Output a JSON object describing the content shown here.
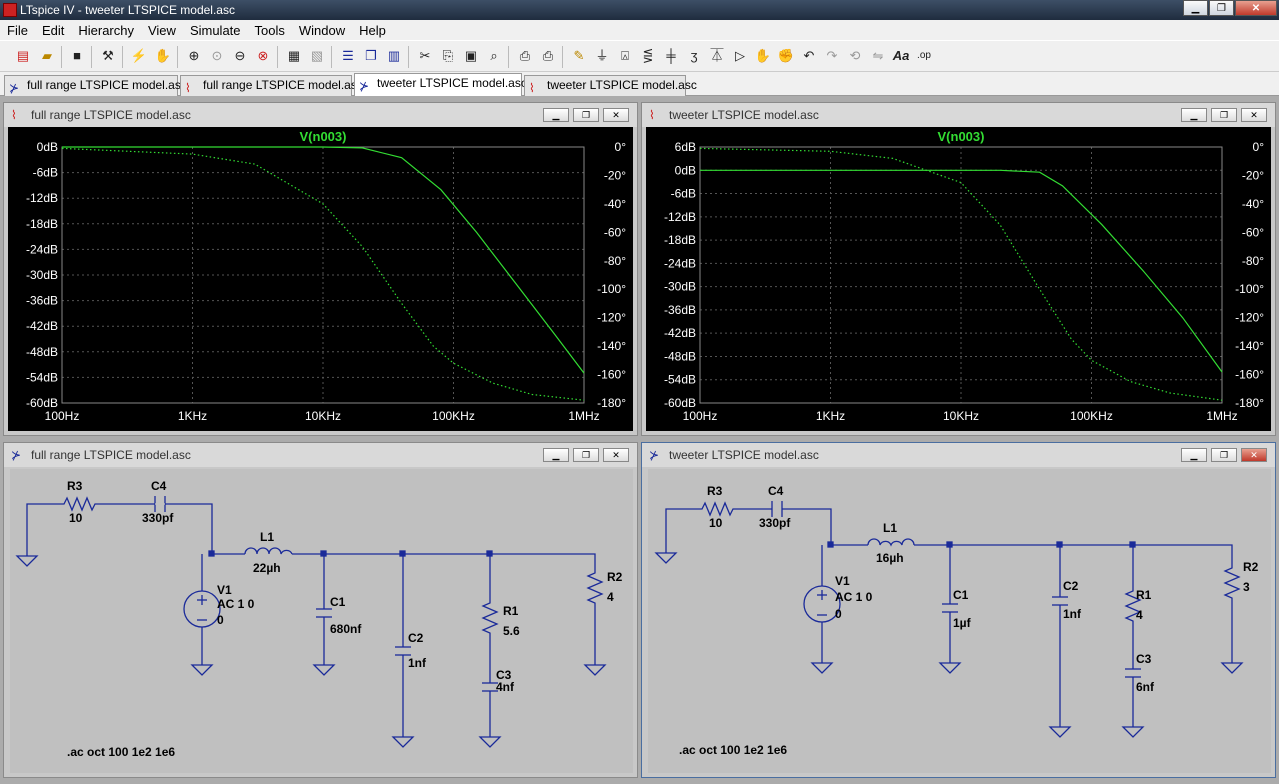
{
  "app": {
    "title": "LTspice IV - tweeter LTSPICE model.asc"
  },
  "menu": [
    "File",
    "Edit",
    "Hierarchy",
    "View",
    "Simulate",
    "Tools",
    "Window",
    "Help"
  ],
  "tabs": [
    {
      "label": "full range LTSPICE model.asc",
      "icon": "schematic-icon",
      "active": false
    },
    {
      "label": "full range LTSPICE model.asc",
      "icon": "waveform-icon",
      "active": false
    },
    {
      "label": "tweeter LTSPICE model.asc",
      "icon": "schematic-icon",
      "active": true
    },
    {
      "label": "tweeter LTSPICE model.asc",
      "icon": "waveform-icon",
      "active": false
    }
  ],
  "windows": {
    "plot_left": {
      "title": "full range LTSPICE model.asc"
    },
    "plot_right": {
      "title": "tweeter LTSPICE model.asc"
    },
    "schem_left": {
      "title": "full range LTSPICE model.asc"
    },
    "schem_right": {
      "title": "tweeter LTSPICE model.asc"
    }
  },
  "colors": {
    "trace": "#33dd33",
    "wire": "#1a2a99",
    "grid": "#555555",
    "plot_bg": "#000000"
  },
  "chart_data": [
    {
      "type": "line",
      "title": "V(n003)",
      "x": {
        "scale": "log",
        "range": [
          100,
          1000000
        ],
        "ticks": [
          "100Hz",
          "1KHz",
          "10KHz",
          "100KHz",
          "1MHz"
        ]
      },
      "y_left": {
        "range": [
          -60,
          0
        ],
        "unit": "dB",
        "ticks": [
          "0dB",
          "-6dB",
          "-12dB",
          "-18dB",
          "-24dB",
          "-30dB",
          "-36dB",
          "-42dB",
          "-48dB",
          "-54dB",
          "-60dB"
        ]
      },
      "y_right": {
        "range": [
          -180,
          0
        ],
        "unit": "°",
        "ticks": [
          "0°",
          "-20°",
          "-40°",
          "-60°",
          "-80°",
          "-100°",
          "-120°",
          "-140°",
          "-160°",
          "-180°"
        ]
      },
      "series": [
        {
          "name": "magnitude",
          "style": "solid",
          "x": [
            100,
            1000,
            10000,
            20000,
            40000,
            80000,
            150000,
            300000,
            600000,
            1000000
          ],
          "y": [
            0,
            0,
            0,
            -0.2,
            -2.5,
            -10,
            -20,
            -32,
            -44,
            -53
          ]
        },
        {
          "name": "phase",
          "style": "dotted",
          "x": [
            100,
            1000,
            3000,
            10000,
            20000,
            40000,
            70000,
            100000,
            200000,
            400000,
            1000000
          ],
          "y": [
            -1,
            -5,
            -12,
            -40,
            -70,
            -110,
            -140,
            -152,
            -166,
            -174,
            -178
          ]
        }
      ],
      "grid": true
    },
    {
      "type": "line",
      "title": "V(n003)",
      "x": {
        "scale": "log",
        "range": [
          100,
          1000000
        ],
        "ticks": [
          "100Hz",
          "1KHz",
          "10KHz",
          "100KHz",
          "1MHz"
        ]
      },
      "y_left": {
        "range": [
          -60,
          6
        ],
        "unit": "dB",
        "ticks": [
          "6dB",
          "0dB",
          "-6dB",
          "-12dB",
          "-18dB",
          "-24dB",
          "-30dB",
          "-36dB",
          "-42dB",
          "-48dB",
          "-54dB",
          "-60dB"
        ]
      },
      "y_right": {
        "range": [
          -180,
          0
        ],
        "unit": "°",
        "ticks": [
          "0°",
          "-20°",
          "-40°",
          "-60°",
          "-80°",
          "-100°",
          "-120°",
          "-140°",
          "-160°",
          "-180°"
        ]
      },
      "series": [
        {
          "name": "magnitude",
          "style": "solid",
          "x": [
            100,
            1000,
            10000,
            20000,
            40000,
            60000,
            120000,
            250000,
            500000,
            1000000
          ],
          "y": [
            0,
            0,
            0,
            0,
            -0.5,
            -4,
            -14,
            -26,
            -38,
            -52
          ]
        },
        {
          "name": "phase",
          "style": "dotted",
          "x": [
            100,
            1000,
            3000,
            10000,
            20000,
            40000,
            70000,
            100000,
            200000,
            400000,
            1000000
          ],
          "y": [
            -1,
            -3,
            -8,
            -25,
            -55,
            -100,
            -135,
            -150,
            -165,
            -173,
            -178
          ]
        }
      ],
      "grid": true
    }
  ],
  "schematic_left": {
    "R3": {
      "name": "R3",
      "value": "10"
    },
    "C4": {
      "name": "C4",
      "value": "330pf"
    },
    "L1": {
      "name": "L1",
      "value": "22µh"
    },
    "V1": {
      "name": "V1",
      "line1": "AC 1 0",
      "line2": "0"
    },
    "C1": {
      "name": "C1",
      "value": "680nf"
    },
    "C2": {
      "name": "C2",
      "value": "1nf"
    },
    "R1": {
      "name": "R1",
      "value": "5.6"
    },
    "C3": {
      "name": "C3",
      "value": "4nf"
    },
    "R2": {
      "name": "R2",
      "value": "4"
    },
    "directive": ".ac oct 100 1e2 1e6"
  },
  "schematic_right": {
    "R3": {
      "name": "R3",
      "value": "10"
    },
    "C4": {
      "name": "C4",
      "value": "330pf"
    },
    "L1": {
      "name": "L1",
      "value": "16µh"
    },
    "V1": {
      "name": "V1",
      "line1": "AC 1 0",
      "line2": "0"
    },
    "C1": {
      "name": "C1",
      "value": "1µf"
    },
    "C2": {
      "name": "C2",
      "value": "1nf"
    },
    "R1": {
      "name": "R1",
      "value": "4"
    },
    "C3": {
      "name": "C3",
      "value": "6nf"
    },
    "R2": {
      "name": "R2",
      "value": "3"
    },
    "directive": ".ac oct 100 1e2 1e6"
  }
}
